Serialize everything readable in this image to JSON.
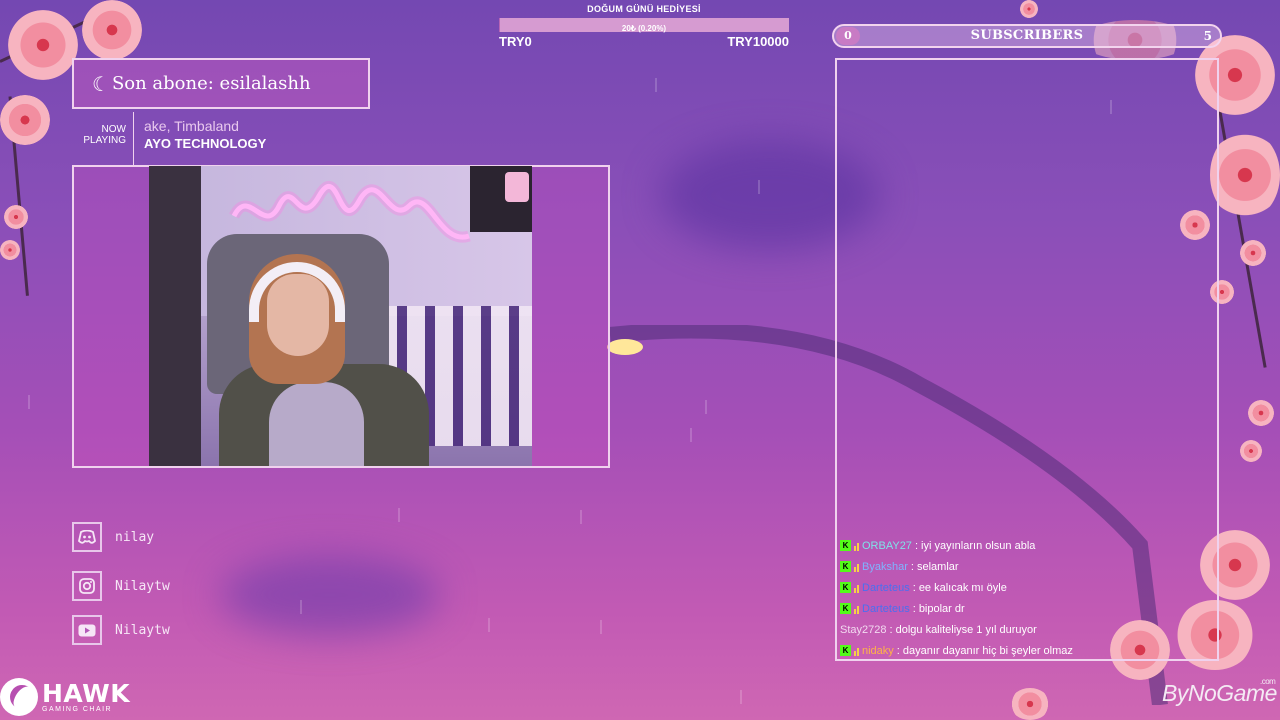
{
  "donation": {
    "title": "DOĞUM GÜNÜ HEDİYESİ",
    "progress_text": "20₺ (0.20%)",
    "progress_fraction": 0.002,
    "start": "TRY0",
    "goal": "TRY10000"
  },
  "last_sub": {
    "text": "Son abone: esilalashh"
  },
  "now_playing": {
    "label_line1": "NOW",
    "label_line2": "PLAYING",
    "artist": "ake, Timbaland",
    "song": "AYO TECHNOLOGY"
  },
  "socials": [
    {
      "icon": "discord-icon",
      "handle": "nilay"
    },
    {
      "icon": "instagram-icon",
      "handle": "Nilaytw"
    },
    {
      "icon": "youtube-icon",
      "handle": "Nilaytw"
    }
  ],
  "subscribers": {
    "current": "0",
    "label": "SUBSCRIBERS",
    "goal": "5",
    "progress_fraction": 0.0
  },
  "chat": [
    {
      "user": "ORBAY27",
      "text": ": iyi yayınların olsun abla",
      "color": "#7fe3e8",
      "badge": true
    },
    {
      "user": "Byakshar",
      "text": ": selamlar",
      "color": "#7fb4ff",
      "badge": true
    },
    {
      "user": "Darteteus",
      "text": ": ee kalıcak mı öyle",
      "color": "#4a6ff0",
      "badge": true
    },
    {
      "user": "Darteteus",
      "text": ": bipolar dr",
      "color": "#4a6ff0",
      "badge": true
    },
    {
      "user": "Stay2728",
      "text": ": dolgu kaliteliyse 1 yıl duruyor",
      "color": "#f2d9f0",
      "badge": false
    },
    {
      "user": "nidaky",
      "text": ": dayanır dayanır hiç bi şeyler olmaz",
      "color": "#ffb347",
      "badge": true
    }
  ],
  "logos": {
    "hawk_name": "HAWK",
    "hawk_sub": "GAMING CHAIR",
    "bynogame": "ByNoGame",
    "bynogame_suffix": ".com"
  },
  "colors": {
    "frame": "#f0d2ee",
    "kick_green": "#53fc18",
    "bg_top": "#7448b2",
    "bg_bottom": "#cf67b3"
  }
}
